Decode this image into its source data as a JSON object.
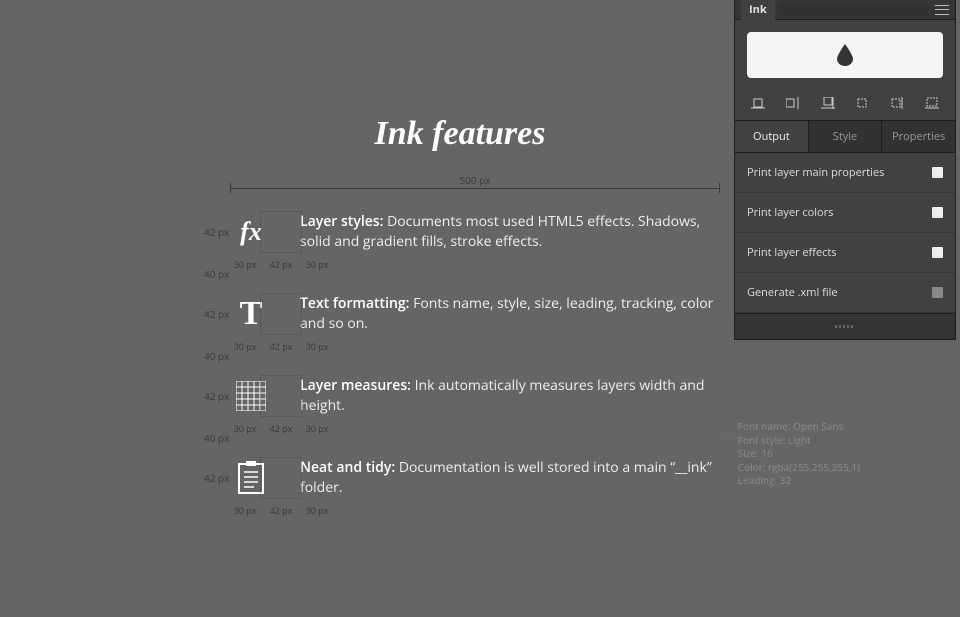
{
  "page": {
    "title": "Ink features"
  },
  "ruler": {
    "width_label": "500 px"
  },
  "row_metrics": {
    "row_h": "42 px",
    "gap_h": "40 px",
    "seg_a": "30 px",
    "seg_b": "42 px",
    "seg_c": "30 px"
  },
  "features": [
    {
      "title": "Layer styles:",
      "desc": " Documents most used HTML5 effects. Shadows, solid and gradient fills, stroke effects."
    },
    {
      "title": "Text formatting:",
      "desc": " Fonts name, style, size, leading, tracking, color and so on."
    },
    {
      "title": "Layer measures:",
      "desc": " Ink automatically measures layers width and height."
    },
    {
      "title": "Neat and tidy:",
      "desc": "  Documentation is well stored into a main “__ink” folder."
    }
  ],
  "panel": {
    "title": "Ink",
    "tabs": [
      "Output",
      "Style",
      "Properties"
    ],
    "active_tab": 0,
    "options": [
      {
        "label": "Print layer main properties",
        "checked": true
      },
      {
        "label": "Print layer colors",
        "checked": true
      },
      {
        "label": "Print layer effects",
        "checked": true
      },
      {
        "label": "Generate .xml file",
        "checked": false
      }
    ]
  },
  "font_info": {
    "l1": "Font name: Open Sans",
    "l2": "Font style: Light",
    "l3": "Size: 16",
    "l4": "Color: rgba(255,255,255,1)",
    "l5": "Leading: 32"
  }
}
